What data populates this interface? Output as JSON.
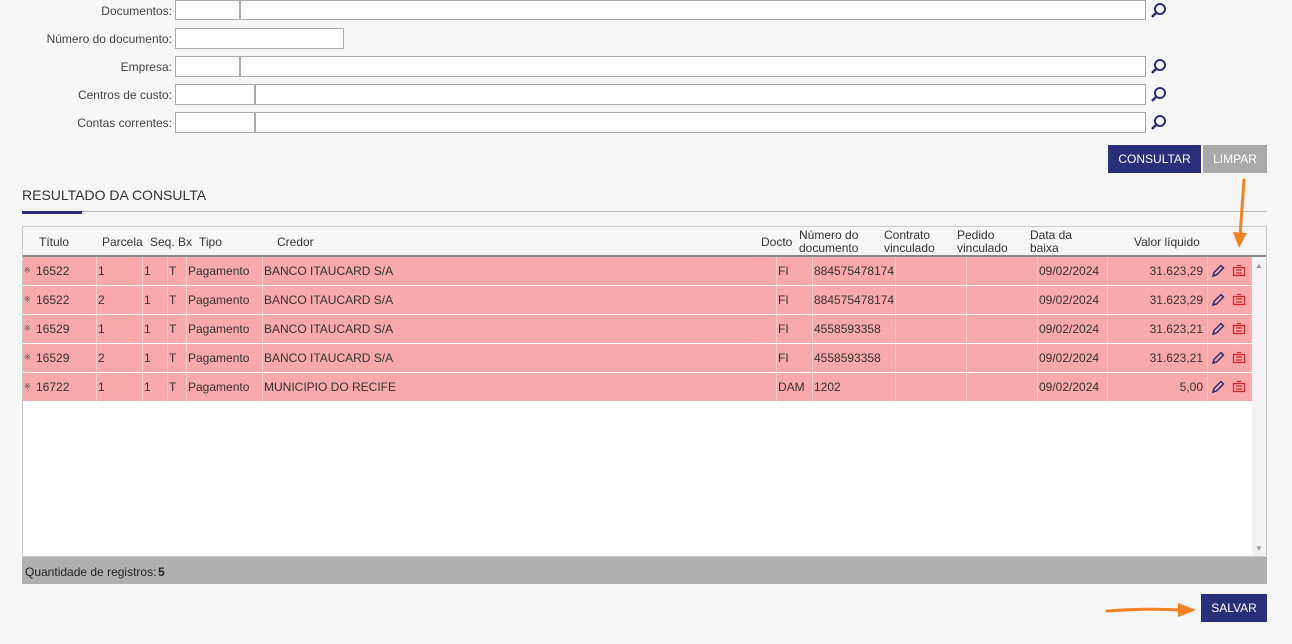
{
  "form": {
    "documentos_label": "Documentos:",
    "numero_documento_label": "Número do documento:",
    "empresa_label": "Empresa:",
    "centros_custo_label": "Centros de custo:",
    "contas_correntes_label": "Contas correntes:"
  },
  "actions": {
    "consultar": "CONSULTAR",
    "limpar": "LIMPAR",
    "salvar": "SALVAR"
  },
  "result": {
    "title": "RESULTADO DA CONSULTA",
    "headers": {
      "titulo": "Título",
      "parcela": "Parcela",
      "seq": "Seq.",
      "bx": "Bx",
      "tipo": "Tipo",
      "credor": "Credor",
      "docto": "Docto",
      "numero_documento_1": "Número do",
      "numero_documento_2": "documento",
      "contrato_1": "Contrato",
      "contrato_2": "vinculado",
      "pedido_1": "Pedido",
      "pedido_2": "vinculado",
      "data_baixa_1": "Data da",
      "data_baixa_2": "baixa",
      "valor_liquido": "Valor líquido"
    },
    "rows": [
      {
        "titulo": "16522",
        "parcela": "1",
        "seq": "1",
        "bx": "T",
        "tipo": "Pagamento",
        "credor": "BANCO ITAUCARD S/A",
        "docto": "FI",
        "numero": "884575478174",
        "contrato": "",
        "pedido": "",
        "data": "09/02/2024",
        "valor": "31.623,29"
      },
      {
        "titulo": "16522",
        "parcela": "2",
        "seq": "1",
        "bx": "T",
        "tipo": "Pagamento",
        "credor": "BANCO ITAUCARD S/A",
        "docto": "FI",
        "numero": "884575478174",
        "contrato": "",
        "pedido": "",
        "data": "09/02/2024",
        "valor": "31.623,29"
      },
      {
        "titulo": "16529",
        "parcela": "1",
        "seq": "1",
        "bx": "T",
        "tipo": "Pagamento",
        "credor": "BANCO ITAUCARD S/A",
        "docto": "FI",
        "numero": "4558593358",
        "contrato": "",
        "pedido": "",
        "data": "09/02/2024",
        "valor": "31.623,21"
      },
      {
        "titulo": "16529",
        "parcela": "2",
        "seq": "1",
        "bx": "T",
        "tipo": "Pagamento",
        "credor": "BANCO ITAUCARD S/A",
        "docto": "FI",
        "numero": "4558593358",
        "contrato": "",
        "pedido": "",
        "data": "09/02/2024",
        "valor": "31.623,21"
      },
      {
        "titulo": "16722",
        "parcela": "1",
        "seq": "1",
        "bx": "T",
        "tipo": "Pagamento",
        "credor": "MUNICIPIO DO RECIFE",
        "docto": "DAM",
        "numero": "1202",
        "contrato": "",
        "pedido": "",
        "data": "09/02/2024",
        "valor": "5,00"
      }
    ],
    "footer_label": "Quantidade de registros:",
    "footer_count": "5"
  },
  "colors": {
    "primary": "#2b2f7b",
    "row_highlight": "#f9a9a9",
    "arrow": "#f58220",
    "disabled": "#a9a9a9"
  },
  "icons": [
    "search-icon",
    "edit-icon",
    "delete-icon",
    "row-marker-icon",
    "scroll-up-icon",
    "scroll-down-icon"
  ]
}
